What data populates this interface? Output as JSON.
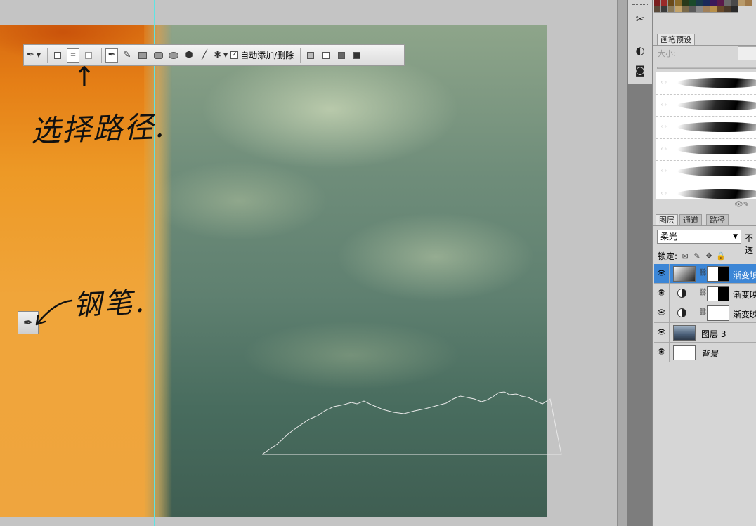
{
  "options_bar": {
    "tool_preset_icon": "pen-icon",
    "mode_icons": [
      "shape-layers-icon",
      "paths-icon",
      "fill-pixels-icon"
    ],
    "draw_icons": [
      "pen-icon",
      "freeform-pen-icon",
      "rectangle-icon",
      "rounded-rectangle-icon",
      "ellipse-icon",
      "polygon-icon",
      "line-icon",
      "custom-shape-icon"
    ],
    "auto_add_delete_label": "自动添加/删除",
    "auto_add_delete_checked": true,
    "combine_icons": [
      "add-to-path-area-icon",
      "subtract-icon",
      "intersect-icon",
      "exclude-overlap-icon"
    ]
  },
  "annotations": {
    "select_path": "选择路径.",
    "pen": "钢笔."
  },
  "dock": {
    "tools": [
      "brush-tools-icon",
      "clone-source-icon",
      "quick-mask-icon"
    ]
  },
  "brush_panel": {
    "tab_label": "画笔预设",
    "size_label": "大小:"
  },
  "layers_panel": {
    "tabs": [
      "图层",
      "通道",
      "路径"
    ],
    "blend_mode": "柔光",
    "opacity_label": "不透",
    "lock_label": "锁定:",
    "layers": [
      {
        "name": "渐变填",
        "type": "gradient-fill",
        "selected": true
      },
      {
        "name": "渐变映",
        "type": "gradient-map",
        "selected": false
      },
      {
        "name": "渐变映",
        "type": "gradient-map",
        "selected": false
      },
      {
        "name": "图层 3",
        "type": "smart-object",
        "selected": false
      },
      {
        "name": "背景",
        "type": "background",
        "selected": false
      }
    ]
  },
  "colors": {
    "accent_selected_layer": "#3c86d6",
    "guide": "#5fe3e3"
  }
}
